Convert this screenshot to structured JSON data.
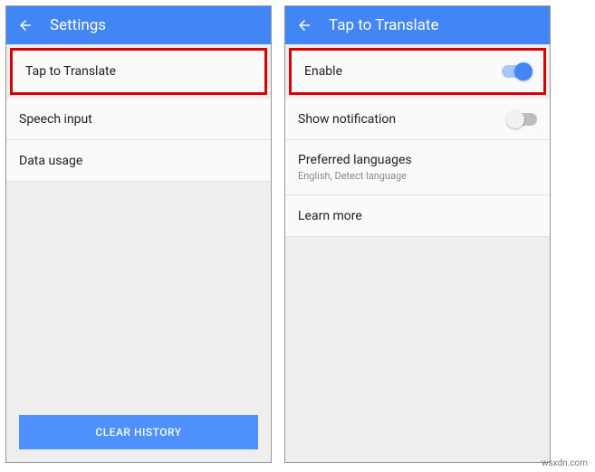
{
  "left": {
    "header": {
      "title": "Settings"
    },
    "items": {
      "tap_to_translate": "Tap to Translate",
      "speech_input": "Speech input",
      "data_usage": "Data usage"
    },
    "clear_history": "CLEAR HISTORY"
  },
  "right": {
    "header": {
      "title": "Tap to Translate"
    },
    "items": {
      "enable": "Enable",
      "show_notification": "Show notification",
      "preferred_languages": "Preferred languages",
      "preferred_languages_sub": "English, Detect language",
      "learn_more": "Learn more"
    }
  },
  "watermark": "wsxdn.com"
}
